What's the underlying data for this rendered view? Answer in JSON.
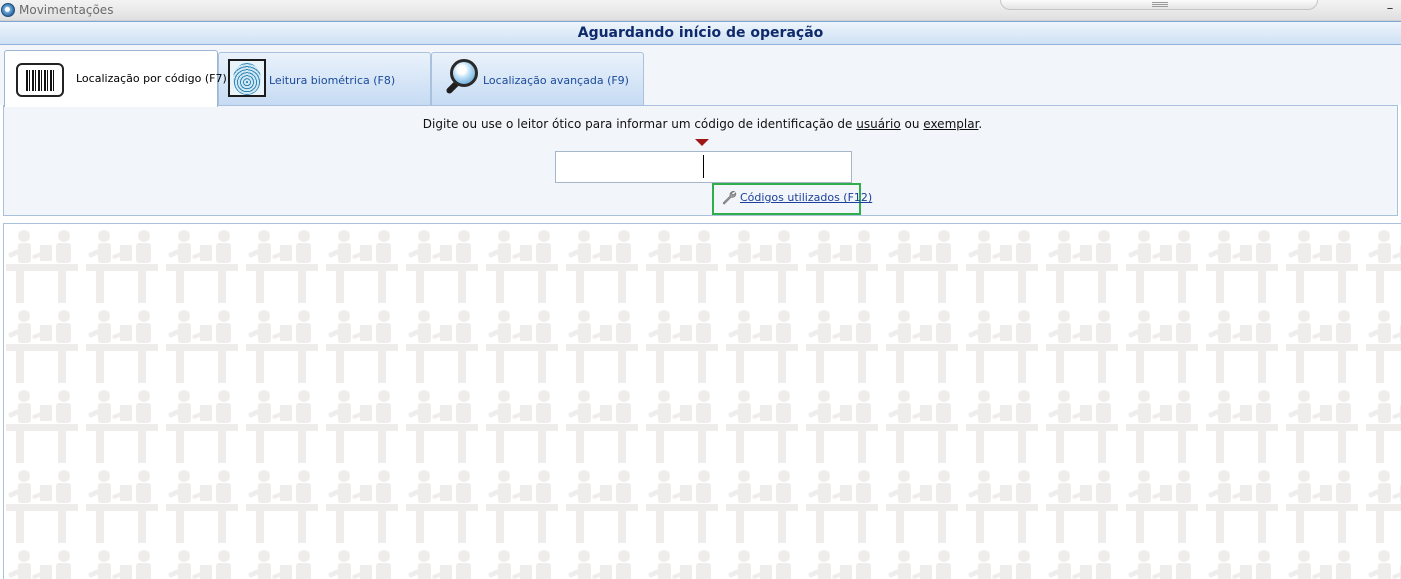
{
  "window": {
    "title": "Movimentações",
    "minimize_label": "–"
  },
  "header": {
    "status": "Aguardando início de operação"
  },
  "tabs": [
    {
      "label": "Localização por código (F7)",
      "icon": "barcode-icon",
      "active": true
    },
    {
      "label": "Leitura biométrica (F8)",
      "icon": "fingerprint-icon",
      "active": false
    },
    {
      "label": "Localização avançada (F9)",
      "icon": "magnifier-icon",
      "active": false
    }
  ],
  "search": {
    "instruction_prefix": "Digite ou use o leitor ótico para informar um código de identificação de",
    "instruction_user": "usuário",
    "instruction_or": "ou",
    "instruction_copy": "exemplar",
    "instruction_end": ".",
    "input_value": "",
    "codes_link": "Códigos utilizados (F12)"
  },
  "colors": {
    "header_text": "#0e2a6c",
    "highlight_border": "#2fae4b",
    "arrow": "#a01515",
    "link": "#1b3f9a"
  }
}
